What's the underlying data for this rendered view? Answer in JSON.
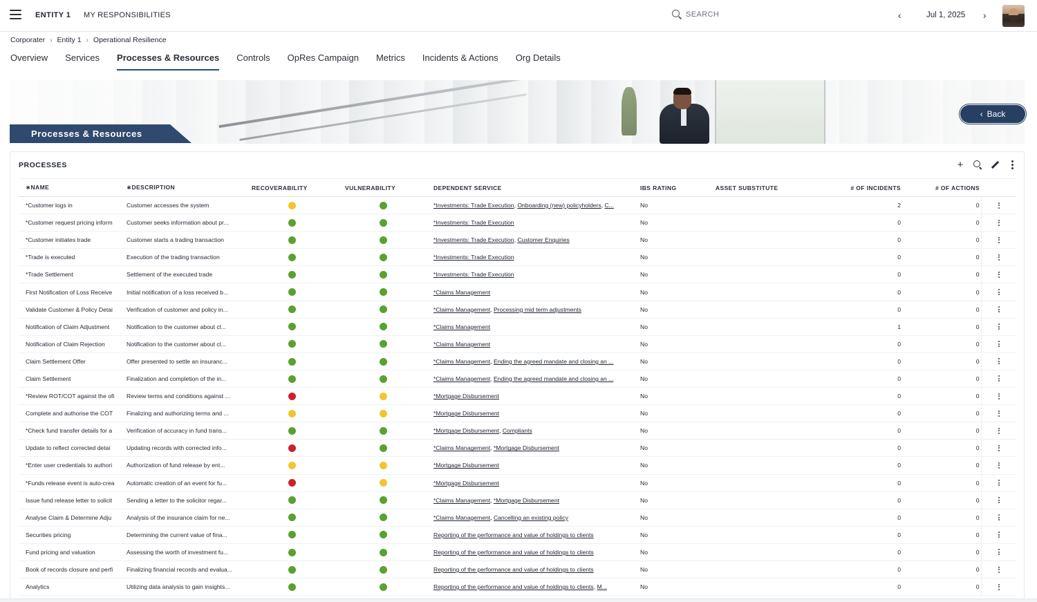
{
  "topbar": {
    "entity": "ENTITY 1",
    "responsibilities": "MY RESPONSIBILITIES",
    "search_label": "SEARCH",
    "date": "Jul 1, 2025",
    "prev": "‹",
    "next": "›"
  },
  "breadcrumb": [
    "Corporater",
    "Entity 1",
    "Operational Resilience"
  ],
  "breadcrumb_sep": "›",
  "tabs": [
    {
      "label": "Overview",
      "active": false
    },
    {
      "label": "Services",
      "active": false
    },
    {
      "label": "Processes & Resources",
      "active": true
    },
    {
      "label": "Controls",
      "active": false
    },
    {
      "label": "OpRes Campaign",
      "active": false
    },
    {
      "label": "Metrics",
      "active": false
    },
    {
      "label": "Incidents & Actions",
      "active": false
    },
    {
      "label": "Org Details",
      "active": false
    }
  ],
  "banner": {
    "title": "Processes & Resources",
    "back_label": "Back",
    "back_chevron": "‹"
  },
  "panel": {
    "title": "PROCESSES",
    "tool_add": "+"
  },
  "status_colors": {
    "green": "#5aa130",
    "yellow": "#f2c530",
    "red": "#cc2229"
  },
  "table": {
    "columns": [
      "∗NAME",
      "∗DESCRIPTION",
      "RECOVERABILITY",
      "VULNERABILITY",
      "DEPENDENT SERVICE",
      "IBS RATING",
      "ASSET SUBSTITUTE",
      "# OF INCIDENTS",
      "# OF ACTIONS"
    ],
    "rows": [
      {
        "name": "*Customer logs in",
        "description": "Customer accesses the system",
        "recoverability": "yellow",
        "vulnerability": "green",
        "services": [
          "*Investments: Trade Execution",
          "Onboarding (new) policyholders",
          "C..."
        ],
        "ibs": "No",
        "asset": "",
        "incidents": "2",
        "actions": "0"
      },
      {
        "name": "*Customer request pricing inform",
        "description": "Customer seeks information about pr...",
        "recoverability": "green",
        "vulnerability": "green",
        "services": [
          "*Investments: Trade Execution"
        ],
        "ibs": "No",
        "asset": "",
        "incidents": "0",
        "actions": "0"
      },
      {
        "name": "*Customer initiates trade",
        "description": "Customer starts a trading transaction",
        "recoverability": "green",
        "vulnerability": "green",
        "services": [
          "*Investments: Trade Execution",
          "Customer Enquiries"
        ],
        "ibs": "No",
        "asset": "",
        "incidents": "0",
        "actions": "0"
      },
      {
        "name": "*Trade is executed",
        "description": "Execution of the trading transaction",
        "recoverability": "green",
        "vulnerability": "green",
        "services": [
          "*Investments: Trade Execution"
        ],
        "ibs": "No",
        "asset": "",
        "incidents": "0",
        "actions": "0"
      },
      {
        "name": "*Trade Settlement",
        "description": "Settlement of the executed trade",
        "recoverability": "green",
        "vulnerability": "green",
        "services": [
          "*Investments: Trade Execution"
        ],
        "ibs": "No",
        "asset": "",
        "incidents": "0",
        "actions": "0"
      },
      {
        "name": "First Notification of Loss Receive",
        "description": "Initial notification of a loss received b...",
        "recoverability": "green",
        "vulnerability": "green",
        "services": [
          "*Claims Management"
        ],
        "ibs": "No",
        "asset": "",
        "incidents": "0",
        "actions": "0"
      },
      {
        "name": "Validate Customer & Policy Detai",
        "description": "Verification of customer and policy in...",
        "recoverability": "green",
        "vulnerability": "green",
        "services": [
          "*Claims Management",
          "Processing mid term adjustments"
        ],
        "ibs": "No",
        "asset": "",
        "incidents": "0",
        "actions": "0"
      },
      {
        "name": "Notification of Claim Adjustment",
        "description": "Notification to the customer about cl...",
        "recoverability": "green",
        "vulnerability": "green",
        "services": [
          "*Claims Management"
        ],
        "ibs": "No",
        "asset": "",
        "incidents": "1",
        "actions": "0"
      },
      {
        "name": "Notification of Claim Rejection",
        "description": "Notification to the customer about cl...",
        "recoverability": "green",
        "vulnerability": "green",
        "services": [
          "*Claims Management"
        ],
        "ibs": "No",
        "asset": "",
        "incidents": "0",
        "actions": "0"
      },
      {
        "name": "Claim Settlement Offer",
        "description": "Offer presented to settle an insuranc...",
        "recoverability": "green",
        "vulnerability": "green",
        "services": [
          "*Claims Management",
          "Ending the agreed mandate and closing an ..."
        ],
        "ibs": "No",
        "asset": "",
        "incidents": "0",
        "actions": "0"
      },
      {
        "name": "Claim Settlement",
        "description": "Finalization and completion of the in...",
        "recoverability": "green",
        "vulnerability": "green",
        "services": [
          "*Claims Management",
          "Ending the agreed mandate and closing an ..."
        ],
        "ibs": "No",
        "asset": "",
        "incidents": "0",
        "actions": "0"
      },
      {
        "name": "*Review ROT/COT against the ofi",
        "description": "Review terms and conditions against ...",
        "recoverability": "red",
        "vulnerability": "yellow",
        "services": [
          "*Mortgage Disbursement"
        ],
        "ibs": "No",
        "asset": "",
        "incidents": "0",
        "actions": "0"
      },
      {
        "name": "Complete and authorise the COT",
        "description": "Finalizing and authorizing terms and ...",
        "recoverability": "yellow",
        "vulnerability": "yellow",
        "services": [
          "*Mortgage Disbursement"
        ],
        "ibs": "No",
        "asset": "",
        "incidents": "0",
        "actions": "0"
      },
      {
        "name": "*Check fund transfer details for a",
        "description": "Verification of accuracy in fund trans...",
        "recoverability": "green",
        "vulnerability": "green",
        "services": [
          "*Mortgage Disbursement",
          "Compliants"
        ],
        "ibs": "No",
        "asset": "",
        "incidents": "0",
        "actions": "0"
      },
      {
        "name": "Update to reflect corrected detai",
        "description": "Updating records with corrected info...",
        "recoverability": "red",
        "vulnerability": "green",
        "services": [
          "*Claims Management",
          "*Mortgage Disbursement"
        ],
        "ibs": "No",
        "asset": "",
        "incidents": "0",
        "actions": "0"
      },
      {
        "name": "*Enter user credentials to authori",
        "description": "Authorization of fund release by ent...",
        "recoverability": "yellow",
        "vulnerability": "yellow",
        "services": [
          "*Mortgage Disbursement"
        ],
        "ibs": "No",
        "asset": "",
        "incidents": "0",
        "actions": "0"
      },
      {
        "name": "*Funds release event is auto-crea",
        "description": "Automatic creation of an event for fu...",
        "recoverability": "red",
        "vulnerability": "yellow",
        "services": [
          "*Mortgage Disbursement"
        ],
        "ibs": "No",
        "asset": "",
        "incidents": "0",
        "actions": "0"
      },
      {
        "name": "Issue fund release letter to solicit",
        "description": "Sending a letter to the solicitor regar...",
        "recoverability": "green",
        "vulnerability": "green",
        "services": [
          "*Claims Management",
          "*Mortgage Disbursement"
        ],
        "ibs": "No",
        "asset": "",
        "incidents": "0",
        "actions": "0"
      },
      {
        "name": "Analyse Claim & Determine Adju",
        "description": "Analysis of the insurance claim for ne...",
        "recoverability": "green",
        "vulnerability": "green",
        "services": [
          "*Claims Management",
          "Cancelling an existing policy"
        ],
        "ibs": "No",
        "asset": "",
        "incidents": "0",
        "actions": "0"
      },
      {
        "name": "Securities pricing",
        "description": "Determining the current value of fina...",
        "recoverability": "green",
        "vulnerability": "green",
        "services": [
          "Reporting of the performance and value of holdings to clients"
        ],
        "ibs": "No",
        "asset": "",
        "incidents": "0",
        "actions": "0"
      },
      {
        "name": "Fund pricing and valuation",
        "description": "Assessing the worth of investment fu...",
        "recoverability": "green",
        "vulnerability": "green",
        "services": [
          "Reporting of the performance and value of holdings to clients"
        ],
        "ibs": "No",
        "asset": "",
        "incidents": "0",
        "actions": "0"
      },
      {
        "name": "Book of records closure and perfi",
        "description": "Finalizing financial records and evalua...",
        "recoverability": "green",
        "vulnerability": "green",
        "services": [
          "Reporting of the performance and value of holdings to clients"
        ],
        "ibs": "No",
        "asset": "",
        "incidents": "0",
        "actions": "0"
      },
      {
        "name": "Analytics",
        "description": "Utilizing data analysis to gain insights...",
        "recoverability": "green",
        "vulnerability": "green",
        "services": [
          "Reporting of the performance and value of holdings to clients",
          "M..."
        ],
        "ibs": "No",
        "asset": "",
        "incidents": "0",
        "actions": "0"
      }
    ]
  }
}
